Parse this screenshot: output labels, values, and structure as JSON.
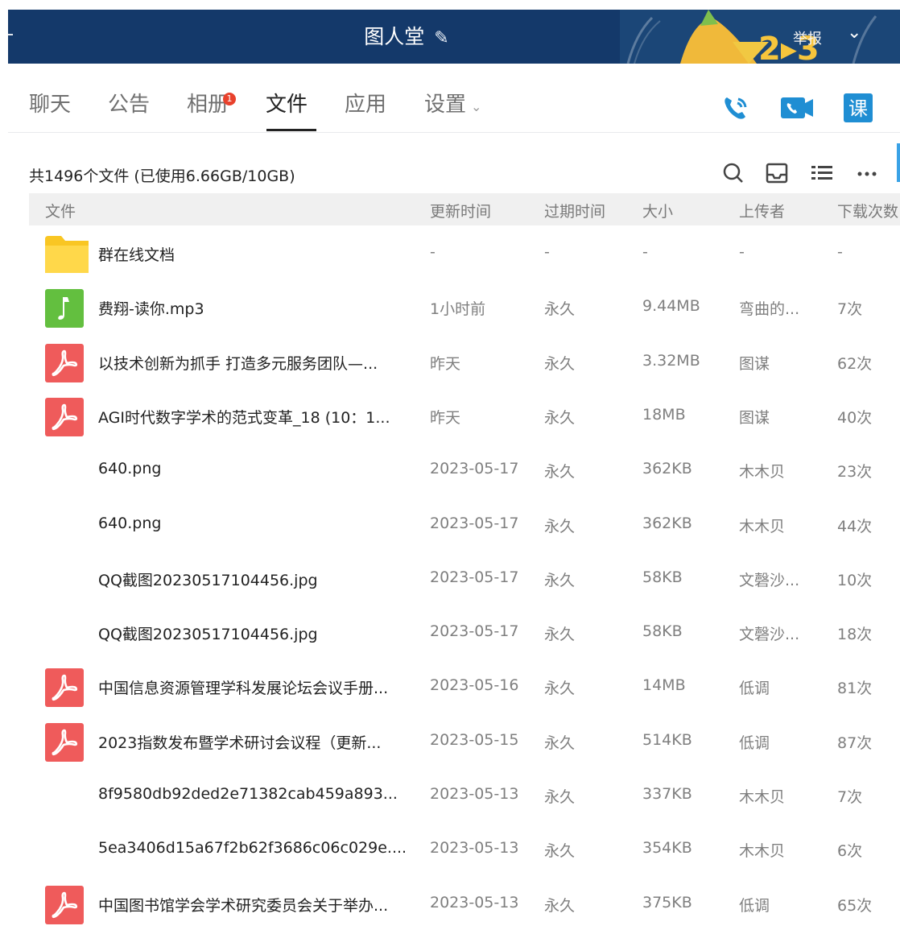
{
  "window": {
    "title": "图人堂",
    "report_label": "举报",
    "banner_text": "2▸3"
  },
  "tabs": [
    {
      "label": "聊天"
    },
    {
      "label": "公告"
    },
    {
      "label": "相册",
      "badge": "1"
    },
    {
      "label": "文件"
    },
    {
      "label": "应用"
    },
    {
      "label": "设置"
    }
  ],
  "toolbar": {
    "course_label": "课"
  },
  "summary": "共1496个文件 (已使用6.66GB/10GB)",
  "columns": [
    "文件",
    "更新时间",
    "过期时间",
    "大小",
    "上传者",
    "下载次数"
  ],
  "files": [
    {
      "type": "folder",
      "name": "群在线文档",
      "updated": "-",
      "expires": "-",
      "size": "-",
      "uploader": "-",
      "downloads": "-"
    },
    {
      "type": "music",
      "name": "费翔-读你.mp3",
      "updated": "1小时前",
      "expires": "永久",
      "size": "9.44MB",
      "uploader": "弯曲的...",
      "downloads": "7次"
    },
    {
      "type": "pdf",
      "name": "以技术创新为抓手 打造多元服务团队—...",
      "updated": "昨天",
      "expires": "永久",
      "size": "3.32MB",
      "uploader": "图谋",
      "downloads": "62次"
    },
    {
      "type": "pdf",
      "name": "AGI时代数字学术的范式变革_18 (10：1...",
      "updated": "昨天",
      "expires": "永久",
      "size": "18MB",
      "uploader": "图谋",
      "downloads": "40次"
    },
    {
      "type": "none",
      "name": "640.png",
      "updated": "2023-05-17",
      "expires": "永久",
      "size": "362KB",
      "uploader": "木木贝",
      "downloads": "23次"
    },
    {
      "type": "none",
      "name": "640.png",
      "updated": "2023-05-17",
      "expires": "永久",
      "size": "362KB",
      "uploader": "木木贝",
      "downloads": "44次"
    },
    {
      "type": "none",
      "name": "QQ截图20230517104456.jpg",
      "updated": "2023-05-17",
      "expires": "永久",
      "size": "58KB",
      "uploader": "文磬沙...",
      "downloads": "10次"
    },
    {
      "type": "none",
      "name": "QQ截图20230517104456.jpg",
      "updated": "2023-05-17",
      "expires": "永久",
      "size": "58KB",
      "uploader": "文磬沙...",
      "downloads": "18次"
    },
    {
      "type": "pdf",
      "name": "中国信息资源管理学科发展论坛会议手册...",
      "updated": "2023-05-16",
      "expires": "永久",
      "size": "14MB",
      "uploader": "低调",
      "downloads": "81次"
    },
    {
      "type": "pdf",
      "name": "2023指数发布暨学术研讨会议程（更新...",
      "updated": "2023-05-15",
      "expires": "永久",
      "size": "514KB",
      "uploader": "低调",
      "downloads": "87次"
    },
    {
      "type": "none",
      "name": "8f9580db92ded2e71382cab459a893...",
      "updated": "2023-05-13",
      "expires": "永久",
      "size": "337KB",
      "uploader": "木木贝",
      "downloads": "7次"
    },
    {
      "type": "none",
      "name": "5ea3406d15a67f2b62f3686c06c029e....",
      "updated": "2023-05-13",
      "expires": "永久",
      "size": "354KB",
      "uploader": "木木贝",
      "downloads": "6次"
    },
    {
      "type": "pdf",
      "name": "中国图书馆学会学术研究委员会关于举办...",
      "updated": "2023-05-13",
      "expires": "永久",
      "size": "375KB",
      "uploader": "低调",
      "downloads": "65次"
    }
  ],
  "colors": {
    "titlebar": "#14396a",
    "pdf": "#ef5b5b",
    "music": "#63bf3f",
    "folder": "#f9c623",
    "accent": "#1f8ed3"
  }
}
